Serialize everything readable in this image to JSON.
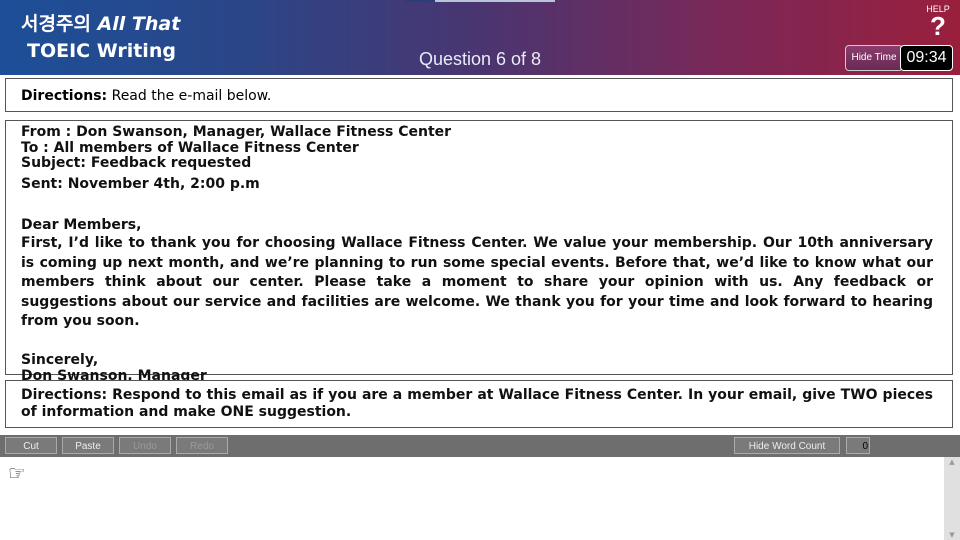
{
  "header": {
    "logo_line1_korean": "서경주의",
    "logo_line1_english": "All That",
    "logo_line2": "TOEIC  Writing",
    "question_progress": "Question 6 of 8",
    "help_label": "HELP",
    "help_icon": "?",
    "hide_time_label": "Hide Time",
    "timer": "09:34"
  },
  "directions_top": {
    "label": "Directions:",
    "text": "Read the e-mail below."
  },
  "email": {
    "from": "From : Don Swanson, Manager, Wallace Fitness Center",
    "to": "To : All members of Wallace Fitness Center",
    "subject": "Subject: Feedback requested",
    "sent": "Sent: November 4th, 2:00 p.m",
    "greeting": "Dear Members,",
    "body": "First, I’d like to thank you for choosing Wallace Fitness Center. We value your membership. Our 10th anniversary is coming up next month, and we’re planning to run some special events. Before that, we’d like to know what our members think about our center. Please take a moment to share your opinion with us. Any feedback or suggestions about our service and facilities are welcome. We thank you for your time and look forward to hearing from you soon.",
    "closing": "Sincerely,",
    "signature": "Don Swanson, Manager"
  },
  "directions_bottom": {
    "text": "Directions: Respond to this email as if you are a member at Wallace Fitness Center. In your email, give TWO pieces of information and make ONE suggestion."
  },
  "toolbar": {
    "cut": "Cut",
    "paste": "Paste",
    "undo": "Undo",
    "redo": "Redo",
    "hide_word_count": "Hide Word Count",
    "word_count": "0"
  },
  "editor": {
    "pointer_icon": "☞"
  },
  "colors": {
    "header_left": "#1d4f98",
    "header_right": "#9a1f3c",
    "toolbar": "#6e6e6e",
    "timer_bg": "#000000"
  }
}
